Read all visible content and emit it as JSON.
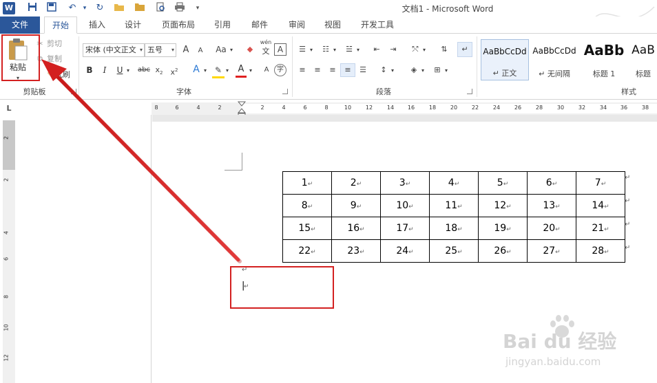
{
  "window": {
    "title": "文档1 - Microsoft Word"
  },
  "quick_access": {
    "word_icon": "W"
  },
  "tabs": [
    {
      "label": "文件",
      "kind": "file"
    },
    {
      "label": "开始",
      "kind": "active"
    },
    {
      "label": "插入"
    },
    {
      "label": "设计"
    },
    {
      "label": "页面布局"
    },
    {
      "label": "引用"
    },
    {
      "label": "邮件"
    },
    {
      "label": "审阅"
    },
    {
      "label": "视图"
    },
    {
      "label": "开发工具"
    }
  ],
  "clipboard": {
    "paste": "粘贴",
    "cut": "剪切",
    "copy": "复制",
    "format_painter": "式刷",
    "group_label": "剪贴板"
  },
  "font": {
    "name": "宋体 (中文正文",
    "size": "五号",
    "aa_menu": "Aa",
    "wen_label": "wén",
    "wen_char": "文",
    "box_a": "A",
    "bold": "B",
    "italic": "I",
    "underline": "U",
    "strike": "abc",
    "sub_base": "x",
    "sub_mark": "2",
    "super_base": "x",
    "super_mark": "2",
    "text_effects": "A",
    "font_color": "A",
    "enclose_char": "字",
    "grow": "A",
    "shrink": "A",
    "group_label": "字体"
  },
  "paragraph": {
    "group_label": "段落"
  },
  "styles": {
    "items": [
      {
        "sample": "AaBbCcDd",
        "name": "↵ 正文"
      },
      {
        "sample": "AaBbCcDd",
        "name": "↵ 无间隔"
      },
      {
        "sample": "AaBb",
        "name": "标题 1"
      },
      {
        "sample": "AaB",
        "name": "标题"
      }
    ],
    "group_label": "样式"
  },
  "ruler": {
    "corner": "L",
    "h_ticks": [
      "8",
      "6",
      "4",
      "2",
      "2",
      "4",
      "6",
      "8",
      "10",
      "12",
      "14",
      "16",
      "18",
      "20",
      "22",
      "24",
      "26",
      "28",
      "30",
      "32",
      "34",
      "36",
      "38"
    ],
    "v_ticks": [
      "2",
      "2",
      "4",
      "6",
      "8",
      "10",
      "12"
    ]
  },
  "table": {
    "rows": [
      [
        "1",
        "2",
        "3",
        "4",
        "5",
        "6",
        "7"
      ],
      [
        "8",
        "9",
        "10",
        "11",
        "12",
        "13",
        "14"
      ],
      [
        "15",
        "16",
        "17",
        "18",
        "19",
        "20",
        "21"
      ],
      [
        "22",
        "23",
        "24",
        "25",
        "26",
        "27",
        "28"
      ]
    ]
  },
  "marks": {
    "paragraph": "↵",
    "cell_end": "↵",
    "cursor": "|"
  },
  "watermark": {
    "brand": "Bai du 经验",
    "url": "jingyan.baidu.com"
  }
}
